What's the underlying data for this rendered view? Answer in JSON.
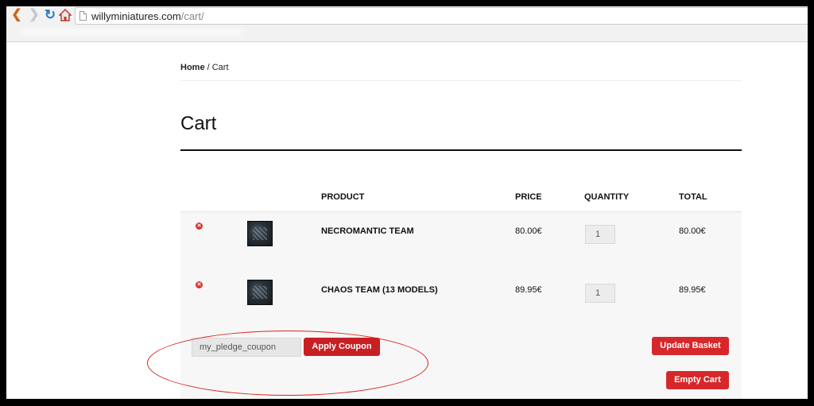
{
  "browser": {
    "url_domain": "willyminiatures.com",
    "url_path": "/cart/",
    "icons": [
      "back-arrow-icon",
      "forward-arrow-icon",
      "reload-icon",
      "home-icon",
      "page-icon"
    ]
  },
  "breadcrumb": {
    "home": "Home",
    "separator": " / ",
    "current": "Cart"
  },
  "page": {
    "title": "Cart"
  },
  "table": {
    "headers": {
      "product": "PRODUCT",
      "price": "PRICE",
      "quantity": "QUANTITY",
      "total": "TOTAL"
    },
    "rows": [
      {
        "name": "NECROMANTIC TEAM",
        "price": "80.00€",
        "quantity": "1",
        "total": "80.00€"
      },
      {
        "name": "CHAOS TEAM (13 MODELS)",
        "price": "89.95€",
        "quantity": "1",
        "total": "89.95€"
      }
    ]
  },
  "actions": {
    "coupon_value": "my_pledge_coupon",
    "apply_label": "Apply Coupon",
    "update_label": "Update Basket",
    "empty_label": "Empty Cart"
  },
  "colors": {
    "accent_red": "#d6282b",
    "annotation_red": "#d9241f"
  }
}
